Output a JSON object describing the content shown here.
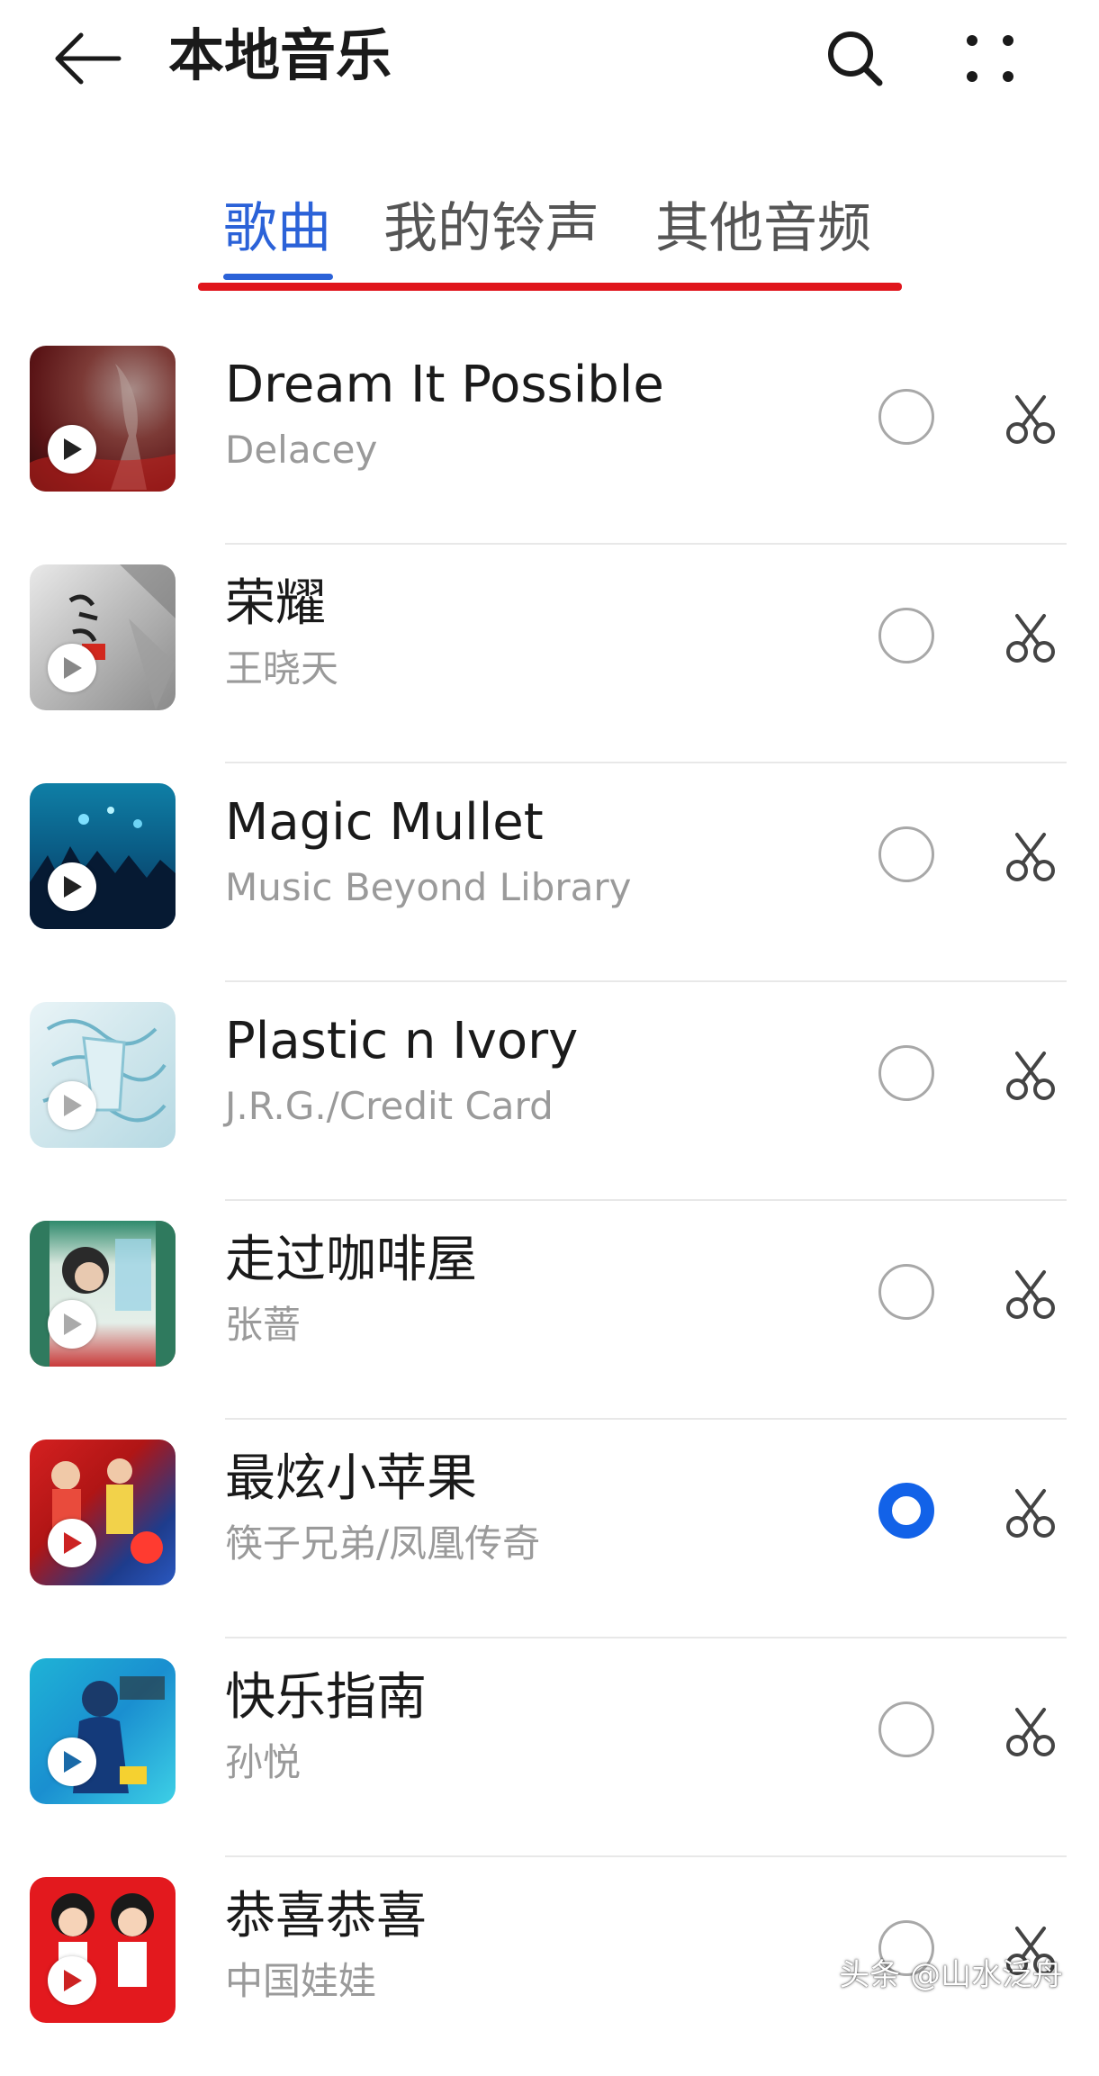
{
  "header": {
    "title": "本地音乐",
    "back_icon": "arrow-left-icon",
    "search_icon": "search-icon",
    "more_icon": "more-dots-icon"
  },
  "tabs": [
    {
      "label": "歌曲",
      "active": true
    },
    {
      "label": "我的铃声",
      "active": false
    },
    {
      "label": "其他音频",
      "active": false
    }
  ],
  "colors": {
    "accent": "#2b62d8",
    "annotation_red": "#e0151c",
    "radio_selected": "#1262e8"
  },
  "songs": [
    {
      "title": "Dream It Possible",
      "artist": "Delacey",
      "selected": false
    },
    {
      "title": "荣耀",
      "artist": "王晓天",
      "selected": false
    },
    {
      "title": "Magic Mullet",
      "artist": "Music Beyond Library",
      "selected": false
    },
    {
      "title": "Plastic n Ivory",
      "artist": "J.R.G./Credit Card",
      "selected": false
    },
    {
      "title": "走过咖啡屋",
      "artist": "张蔷",
      "selected": false
    },
    {
      "title": "最炫小苹果",
      "artist": "筷子兄弟/凤凰传奇",
      "selected": true
    },
    {
      "title": "快乐指南",
      "artist": "孙悦",
      "selected": false
    },
    {
      "title": "恭喜恭喜",
      "artist": "中国娃娃",
      "selected": false
    }
  ],
  "watermark": "头条 @山水泛舟"
}
